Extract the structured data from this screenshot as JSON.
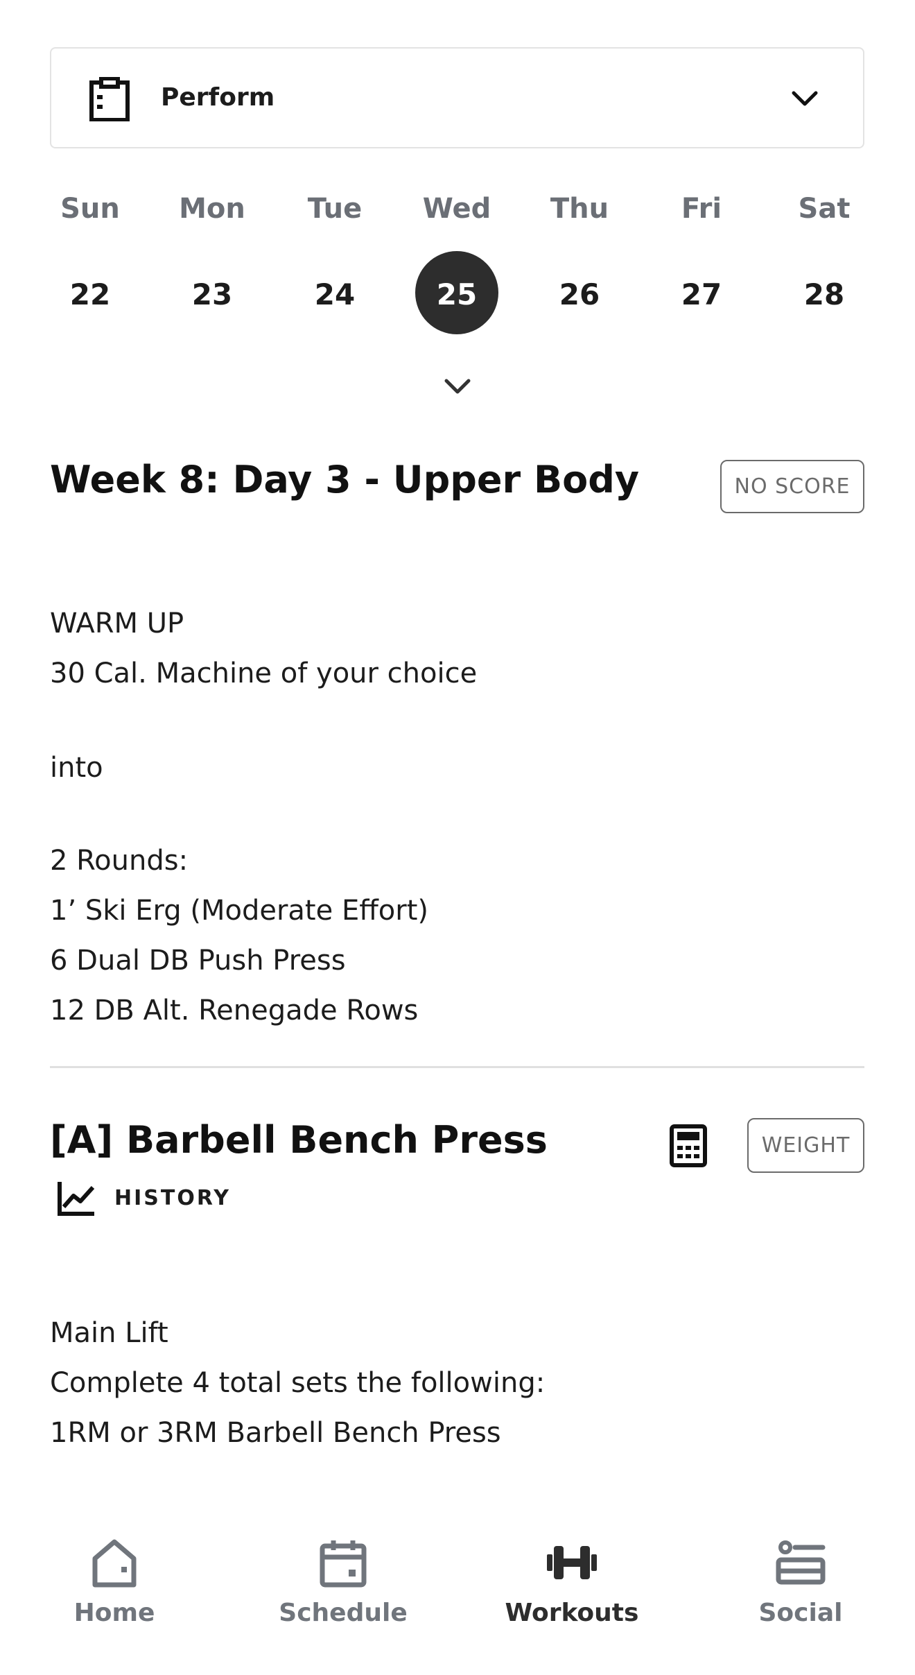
{
  "program_selector": {
    "label": "Perform",
    "icon": "clipboard-icon",
    "chevron": "chevron-down-icon"
  },
  "calendar": {
    "days": [
      {
        "name": "Sun",
        "date": "22"
      },
      {
        "name": "Mon",
        "date": "23"
      },
      {
        "name": "Tue",
        "date": "24"
      },
      {
        "name": "Wed",
        "date": "25",
        "selected": true
      },
      {
        "name": "Thu",
        "date": "26"
      },
      {
        "name": "Fri",
        "date": "27"
      },
      {
        "name": "Sat",
        "date": "28"
      }
    ],
    "selected_color": "#2d2d2d"
  },
  "workout": {
    "title": "Week 8: Day 3 - Upper Body",
    "score_badge": "NO SCORE",
    "warmup_lines": [
      "WARM UP",
      "30 Cal. Machine of your choice",
      "",
      "into",
      "",
      "2 Rounds:",
      "1’ Ski Erg (Moderate Effort)",
      "6 Dual DB Push Press",
      "12 DB Alt. Renegade Rows"
    ]
  },
  "section_a": {
    "title": "[A] Barbell Bench Press",
    "badge": "WEIGHT",
    "history_label": "HISTORY",
    "lines": [
      "Main Lift",
      "Complete 4 total sets the following:",
      "1RM or 3RM Barbell Bench Press"
    ]
  },
  "bottom_nav": {
    "items": [
      {
        "label": "Home",
        "icon": "home-icon"
      },
      {
        "label": "Schedule",
        "icon": "calendar-icon"
      },
      {
        "label": "Workouts",
        "icon": "dumbbell-icon",
        "active": true
      },
      {
        "label": "Social",
        "icon": "social-icon"
      }
    ]
  }
}
